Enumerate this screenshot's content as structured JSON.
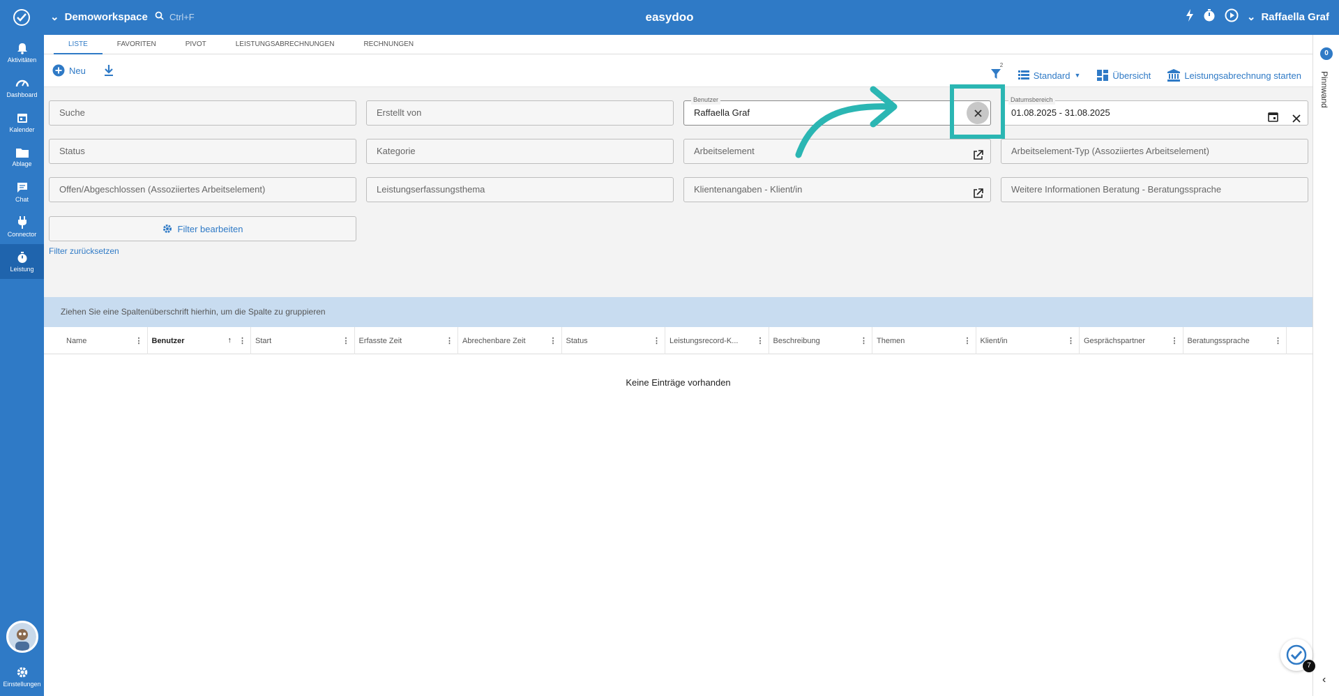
{
  "header": {
    "workspace": "Demoworkspace",
    "search_hint": "Ctrl+F",
    "app_title": "easydoo",
    "user_name": "Raffaella Graf"
  },
  "sidebar": {
    "items": [
      {
        "label": "Aktivitäten",
        "icon": "bell-icon"
      },
      {
        "label": "Dashboard",
        "icon": "gauge-icon"
      },
      {
        "label": "Kalender",
        "icon": "calendar-icon"
      },
      {
        "label": "Ablage",
        "icon": "folder-icon"
      },
      {
        "label": "Chat",
        "icon": "chat-icon"
      },
      {
        "label": "Connector",
        "icon": "plug-icon"
      },
      {
        "label": "Leistung",
        "icon": "stopwatch-icon"
      }
    ],
    "settings_label": "Einstellungen"
  },
  "tabs": [
    "LISTE",
    "FAVORITEN",
    "PIVOT",
    "LEISTUNGSABRECHNUNGEN",
    "RECHNUNGEN"
  ],
  "toolbar": {
    "new_label": "Neu",
    "filter_count": "2",
    "view_label": "Standard",
    "overview_label": "Übersicht",
    "billing_label": "Leistungsabrechnung starten"
  },
  "filters": {
    "search": "Suche",
    "created_by": "Erstellt von",
    "user_label": "Benutzer",
    "user_value": "Raffaella Graf",
    "date_label": "Datumsbereich",
    "date_value": "01.08.2025 - 31.08.2025",
    "status": "Status",
    "category": "Kategorie",
    "work_element": "Arbeitselement",
    "work_element_type": "Arbeitselement-Typ (Assoziiertes Arbeitselement)",
    "open_closed": "Offen/Abgeschlossen (Assoziiertes Arbeitselement)",
    "topic": "Leistungserfassungsthema",
    "client": "Klientenangaben - Klient/in",
    "language": "Weitere Informationen Beratung - Beratungssprache",
    "edit_label": "Filter bearbeiten",
    "reset_label": "Filter zurücksetzen"
  },
  "grid": {
    "group_hint": "Ziehen Sie eine Spaltenüberschrift hierhin, um die Spalte zu gruppieren",
    "columns": [
      "Name",
      "Benutzer",
      "Start",
      "Erfasste Zeit",
      "Abrechenbare Zeit",
      "Status",
      "Leistungsrecord-K...",
      "Beschreibung",
      "Themen",
      "Klient/in",
      "Gesprächspartner",
      "Beratungssprache"
    ],
    "empty_text": "Keine Einträge vorhanden"
  },
  "right_panel": {
    "count": "0",
    "label": "Pinnwand"
  },
  "fab_count": "7",
  "colors": {
    "primary": "#2f7ac6",
    "highlight": "#2bb6b3"
  }
}
